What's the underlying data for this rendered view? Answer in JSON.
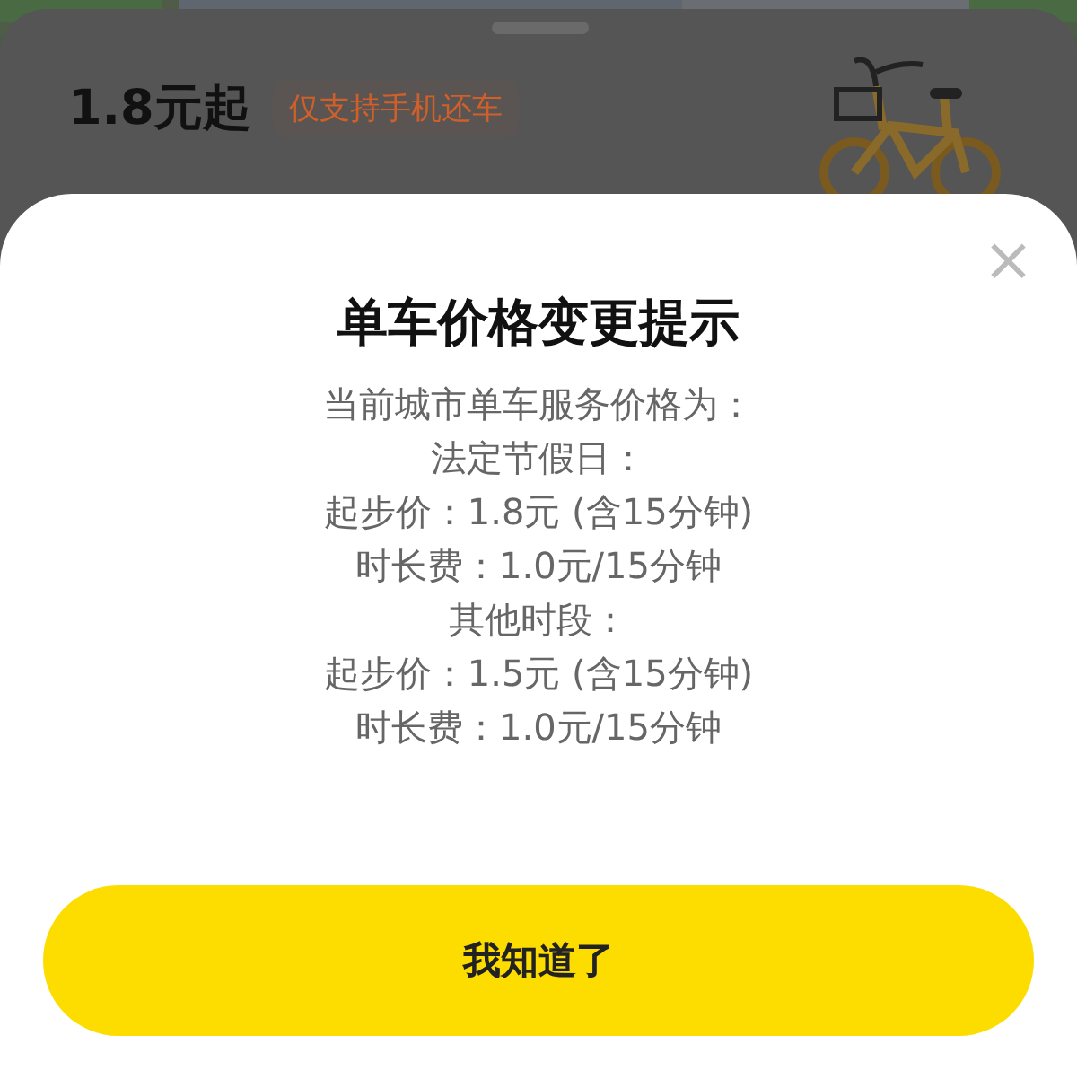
{
  "background_sheet": {
    "price": "1.8元起",
    "tag": "仅支持手机还车"
  },
  "dialog": {
    "close": "×",
    "title": "单车价格变更提示",
    "lines": [
      "当前城市单车服务价格为：",
      "法定节假日：",
      "起步价：1.8元 (含15分钟)",
      "时长费：1.0元/15分钟",
      "其他时段：",
      "起步价：1.5元 (含15分钟)",
      "时长费：1.0元/15分钟"
    ],
    "button": "我知道了"
  }
}
